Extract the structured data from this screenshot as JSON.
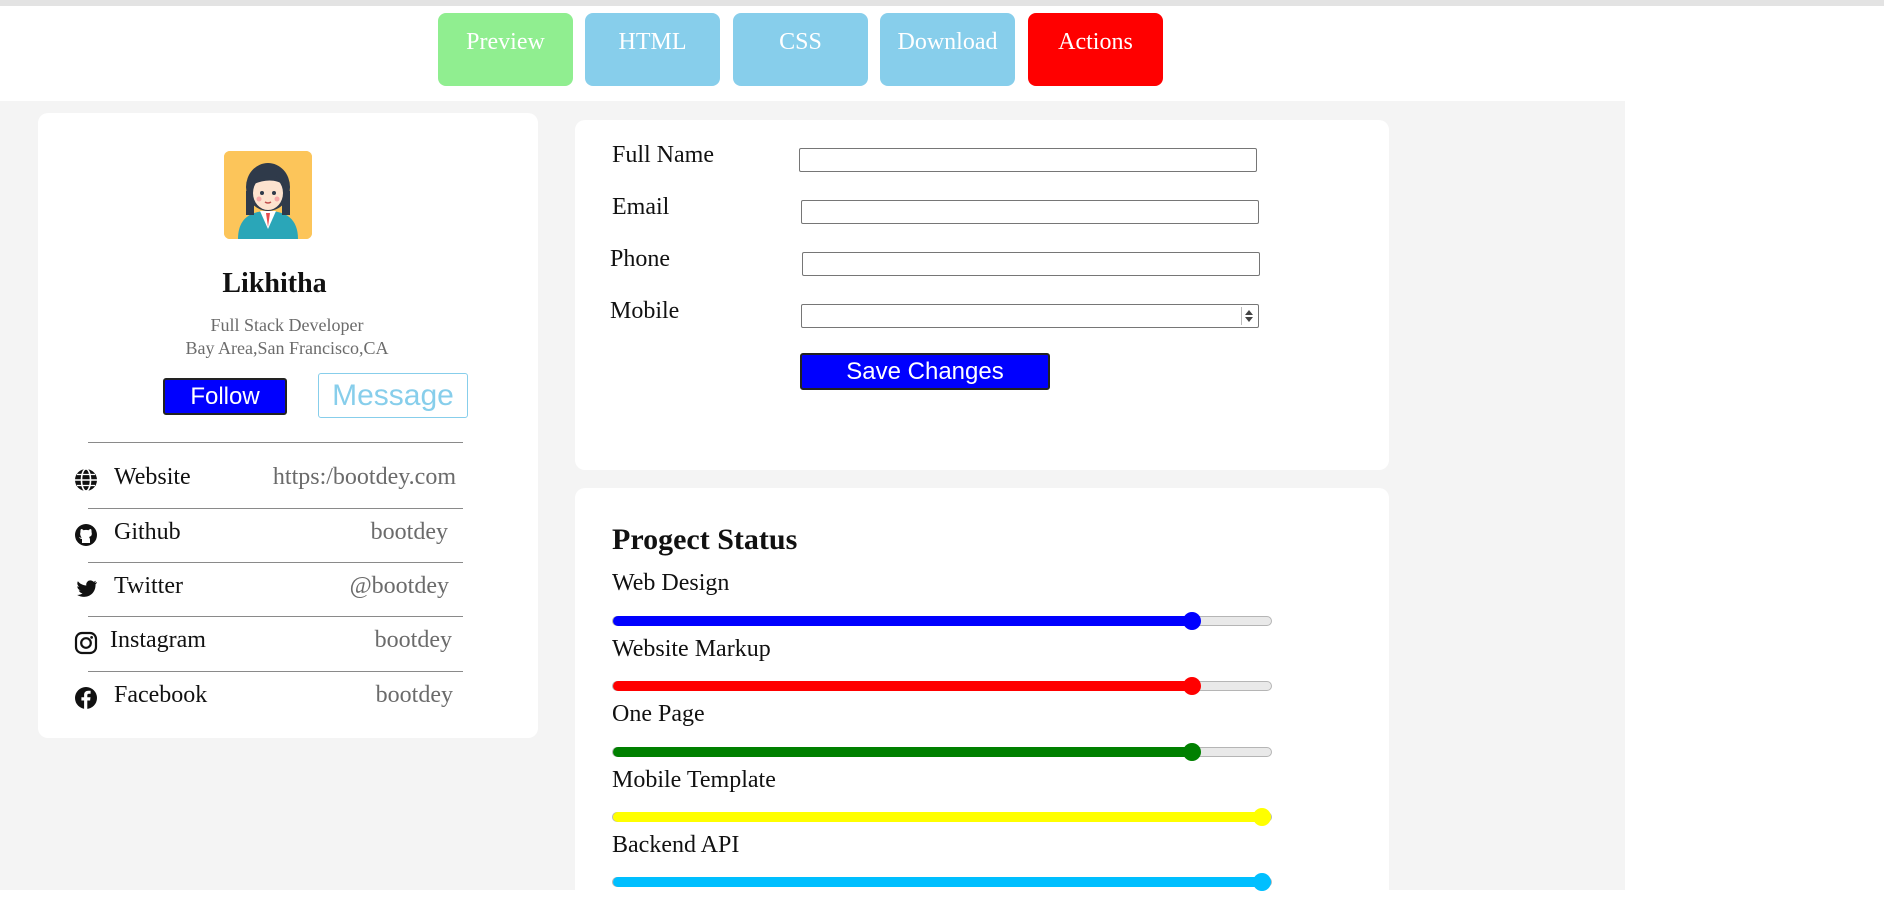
{
  "toolbar": {
    "tabs": [
      {
        "label": "Preview",
        "color": "#90ee90"
      },
      {
        "label": "HTML",
        "color": "#87ceeb"
      },
      {
        "label": "CSS",
        "color": "#87ceeb"
      },
      {
        "label": "Download",
        "color": "#87ceeb"
      },
      {
        "label": "Actions",
        "color": "#ff0000"
      }
    ]
  },
  "profile": {
    "avatar_icon": "girl-avatar-icon",
    "name": "Likhitha",
    "title": "Full Stack Developer",
    "location": "Bay Area,San Francisco,CA",
    "follow_label": "Follow",
    "message_label": "Message",
    "social": [
      {
        "icon": "globe-icon",
        "label": "Website",
        "value": "https:/bootdey.com"
      },
      {
        "icon": "github-icon",
        "label": "Github",
        "value": "bootdey"
      },
      {
        "icon": "twitter-icon",
        "label": "Twitter",
        "value": "@bootdey"
      },
      {
        "icon": "instagram-icon",
        "label": "Instagram",
        "value": "bootdey"
      },
      {
        "icon": "facebook-icon",
        "label": "Facebook",
        "value": "bootdey"
      }
    ]
  },
  "form": {
    "fields": [
      {
        "label": "Full Name",
        "value": ""
      },
      {
        "label": "Email",
        "value": ""
      },
      {
        "label": "Phone",
        "value": ""
      },
      {
        "label": "Mobile",
        "value": ""
      }
    ],
    "save_label": "Save Changes"
  },
  "status": {
    "title": "Progect Status",
    "items": [
      {
        "label": "Web Design",
        "value": 0.88,
        "color": "#0000ff"
      },
      {
        "label": "Website Markup",
        "value": 0.88,
        "color": "#ff0000"
      },
      {
        "label": "One Page",
        "value": 0.88,
        "color": "#008000"
      },
      {
        "label": "Mobile Template",
        "value": 1.0,
        "color": "#ffff00"
      },
      {
        "label": "Backend API",
        "value": 1.0,
        "color": "#00bfff"
      }
    ]
  }
}
